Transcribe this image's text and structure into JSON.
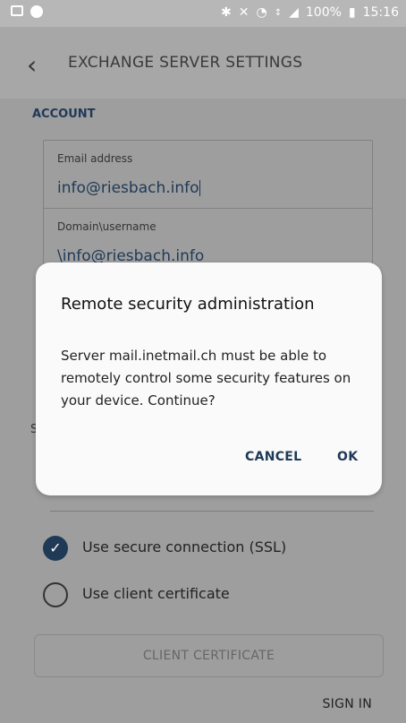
{
  "status_bar": {
    "icons_left": [
      "image-icon",
      "face-icon"
    ],
    "icons_right": [
      "bluetooth-icon",
      "mute-icon",
      "alarm-icon",
      "data-icon",
      "signal-icon"
    ],
    "battery": "100%",
    "time": "15:16"
  },
  "app_bar": {
    "title": "EXCHANGE SERVER SETTINGS"
  },
  "account": {
    "section_label": "ACCOUNT",
    "email_label": "Email address",
    "email_value": "info@riesbach.info",
    "domain_label": "Domain\\username",
    "domain_value": "\\info@riesbach.info"
  },
  "server_section_letter": "S",
  "options": {
    "ssl_label": "Use secure connection (SSL)",
    "ssl_checked": true,
    "client_cert_label": "Use client certificate",
    "client_cert_checked": false
  },
  "client_certificate_button": "CLIENT CERTIFICATE",
  "sign_in": "SIGN IN",
  "dialog": {
    "title": "Remote security administration",
    "message": "Server mail.inetmail.ch must be able to remotely control some security features on your device. Continue?",
    "cancel": "CANCEL",
    "ok": "OK"
  }
}
